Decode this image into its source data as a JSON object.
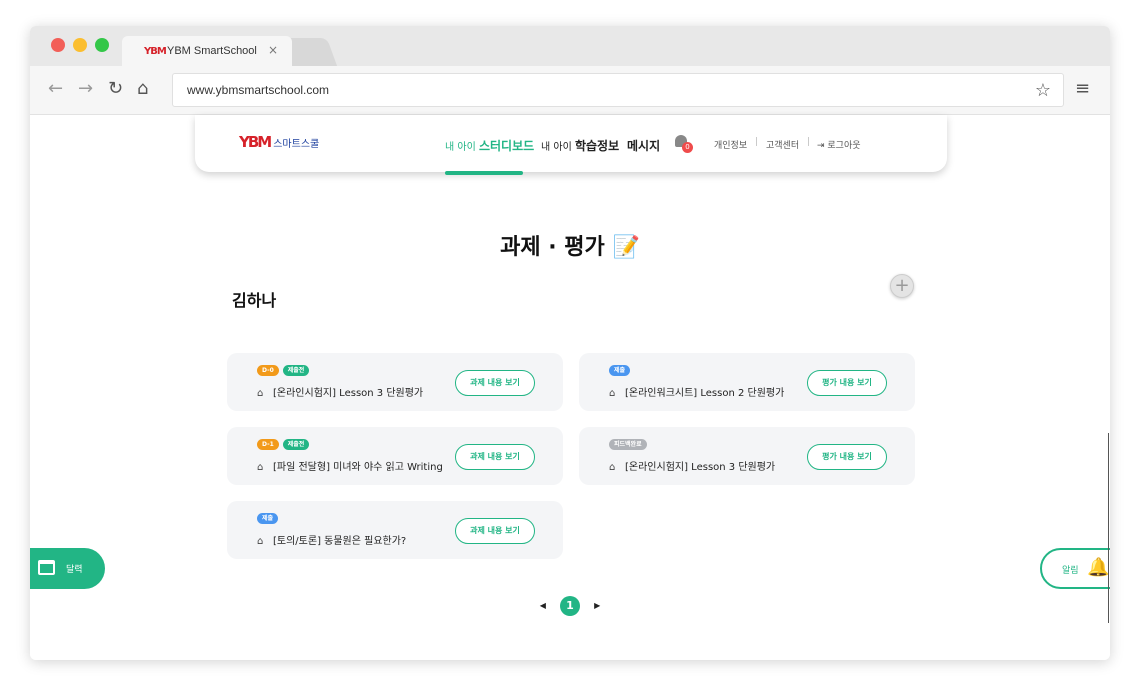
{
  "browser": {
    "tab_logo": "YBM",
    "tab_title": "YBM SmartSchool",
    "tab_close": "×",
    "url": "www.ybmsmartschool.com",
    "icons": [
      "back-arrow-icon",
      "forward-arrow-icon",
      "reload-icon",
      "home-icon",
      "star-icon",
      "hamburger-menu-icon"
    ]
  },
  "header": {
    "logo_mark": "YBM",
    "logo_text": "스마트스쿨",
    "nav": {
      "dashboard_prefix": "내 아이",
      "dashboard_main": "스터디보드",
      "study_prefix": "내 아이",
      "study_main": "학습정보",
      "message": "메시지"
    },
    "notification_count": "0",
    "utils": [
      "개인정보",
      "고객센터",
      "로그아웃"
    ]
  },
  "main": {
    "title": "과제 · 평가",
    "title_icon": "📝",
    "student_name": "김하나",
    "add_label": "+",
    "cards": [
      {
        "badges": [
          {
            "text": "D-0",
            "color": "orange"
          },
          {
            "text": "제출전",
            "color": "green"
          }
        ],
        "title": "[온라인시험지] Lesson 3 단원평가",
        "button": "과제 내용 보기"
      },
      {
        "badges": [
          {
            "text": "제출",
            "color": "blue"
          }
        ],
        "title": "[온라인워크시트] Lesson 2 단원평가",
        "button": "평가 내용 보기"
      },
      {
        "badges": [
          {
            "text": "D-1",
            "color": "orange"
          },
          {
            "text": "제출전",
            "color": "green"
          }
        ],
        "title": "[파일 전달형] 미녀와 야수 읽고 Writing",
        "button": "과제 내용 보기"
      },
      {
        "badges": [
          {
            "text": "피드백완료",
            "color": "gray"
          }
        ],
        "title": "[온라인시험지] Lesson 3 단원평가",
        "button": "평가 내용 보기"
      },
      {
        "badges": [
          {
            "text": "제출",
            "color": "blue"
          }
        ],
        "title": "[토의/토론] 동물원은 필요한가?",
        "button": "과제 내용 보기"
      }
    ],
    "pagination": {
      "prev": "◀",
      "current": "1",
      "next": "▶"
    }
  },
  "floating": {
    "calendar_label": "달력",
    "alarm_label": "알림"
  },
  "colors": {
    "accent": "#22b585",
    "orange": "#f29a1a",
    "blue": "#4a96f0",
    "gray": "#b0b3b8",
    "brand_red": "#d6222a"
  }
}
